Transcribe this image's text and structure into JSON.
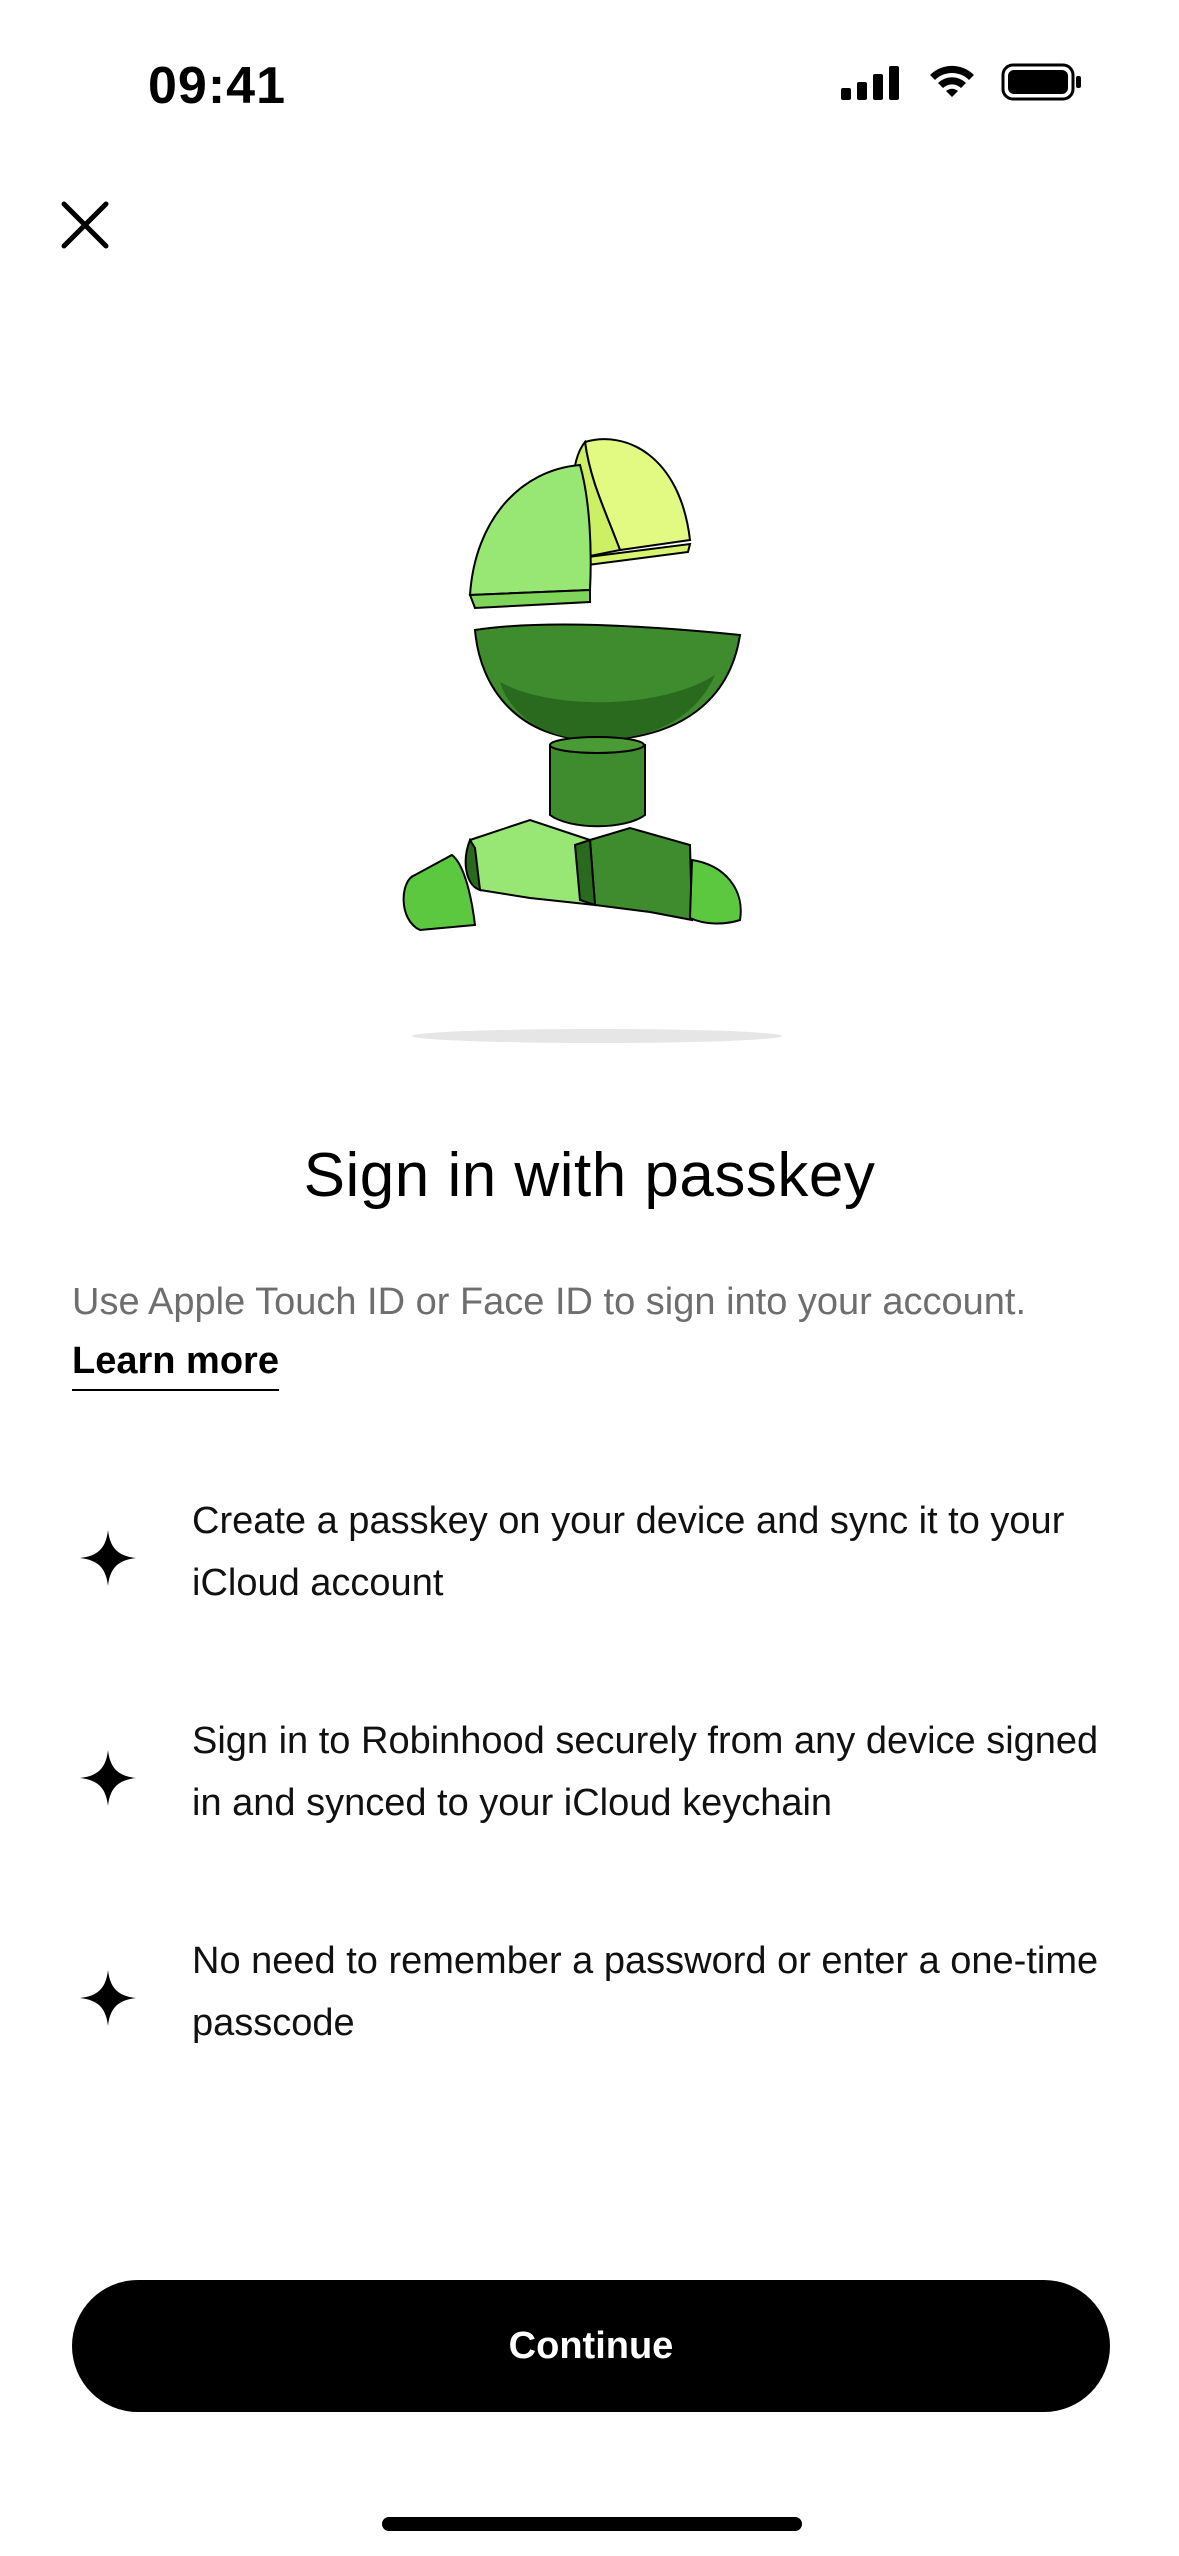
{
  "status_bar": {
    "time": "09:41",
    "signal_icon": "cellular-signal-icon",
    "wifi_icon": "wifi-icon",
    "battery_icon": "battery-icon"
  },
  "header": {
    "close_icon": "close-icon"
  },
  "illustration": {
    "name": "passkey-robot-illustration"
  },
  "main": {
    "title": "Sign in with passkey",
    "subtitle": "Use Apple Touch ID or Face ID to sign into your account.",
    "learn_more": "Learn more",
    "features": [
      {
        "icon": "sparkle-icon",
        "text": "Create a passkey on your device and sync it to your iCloud account"
      },
      {
        "icon": "sparkle-icon",
        "text": "Sign in to Robinhood securely from any device signed in and synced to your iCloud keychain"
      },
      {
        "icon": "sparkle-icon",
        "text": "No need to remember a password or enter a one-time passcode"
      }
    ]
  },
  "footer": {
    "continue_label": "Continue"
  },
  "colors": {
    "primary": "#000000",
    "background": "#ffffff",
    "subtitle_gray": "#6e6e6e",
    "green_light": "#98e673",
    "green_dark": "#3e8c2d",
    "lime": "#e2fa82"
  }
}
